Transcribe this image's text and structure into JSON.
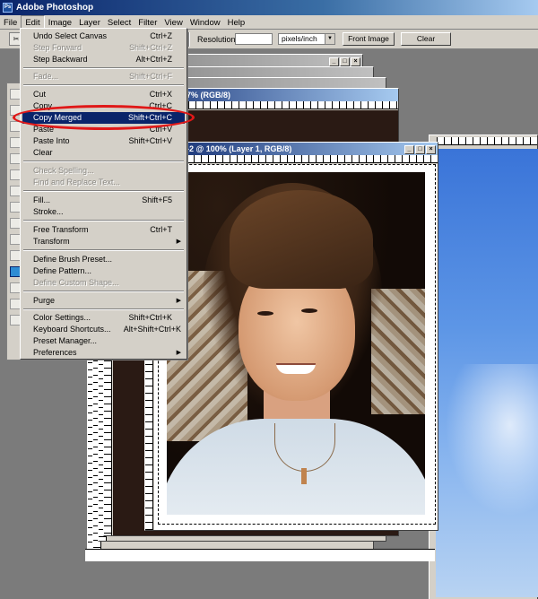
{
  "app": {
    "title": "Adobe Photoshop",
    "icon": "photoshop-app-icon"
  },
  "menubar": [
    "File",
    "Edit",
    "Image",
    "Layer",
    "Select",
    "Filter",
    "View",
    "Window",
    "Help"
  ],
  "options_bar": {
    "resolution_label": "Resolution:",
    "resolution_value": "",
    "resolution_unit": "pixels/inch",
    "front_image_label": "Front Image",
    "clear_label": "Clear"
  },
  "documents": {
    "back_title_fragment": "7% (RGB/8)",
    "front_title": "-2 @ 100% (Layer 1, RGB/8)",
    "window_buttons": [
      "_",
      "□",
      "×"
    ]
  },
  "edit_menu": {
    "items": [
      {
        "label": "Undo Select Canvas",
        "shortcut": "Ctrl+Z",
        "state": "enabled"
      },
      {
        "label": "Step Forward",
        "shortcut": "Shift+Ctrl+Z",
        "state": "disabled"
      },
      {
        "label": "Step Backward",
        "shortcut": "Alt+Ctrl+Z",
        "state": "enabled"
      },
      {
        "label": "Fade...",
        "shortcut": "Shift+Ctrl+F",
        "state": "disabled"
      },
      {
        "label": "Cut",
        "shortcut": "Ctrl+X",
        "state": "enabled"
      },
      {
        "label": "Copy",
        "shortcut": "Ctrl+C",
        "state": "enabled"
      },
      {
        "label": "Copy Merged",
        "shortcut": "Shift+Ctrl+C",
        "state": "highlighted"
      },
      {
        "label": "Paste",
        "shortcut": "Ctrl+V",
        "state": "enabled"
      },
      {
        "label": "Paste Into",
        "shortcut": "Shift+Ctrl+V",
        "state": "enabled"
      },
      {
        "label": "Clear",
        "shortcut": "",
        "state": "enabled"
      },
      {
        "label": "Check Spelling...",
        "shortcut": "",
        "state": "disabled"
      },
      {
        "label": "Find and Replace Text...",
        "shortcut": "",
        "state": "disabled"
      },
      {
        "label": "Fill...",
        "shortcut": "Shift+F5",
        "state": "enabled"
      },
      {
        "label": "Stroke...",
        "shortcut": "",
        "state": "enabled"
      },
      {
        "label": "Free Transform",
        "shortcut": "Ctrl+T",
        "state": "enabled"
      },
      {
        "label": "Transform",
        "shortcut": "",
        "state": "submenu"
      },
      {
        "label": "Define Brush Preset...",
        "shortcut": "",
        "state": "enabled"
      },
      {
        "label": "Define Pattern...",
        "shortcut": "",
        "state": "enabled"
      },
      {
        "label": "Define Custom Shape...",
        "shortcut": "",
        "state": "disabled"
      },
      {
        "label": "Purge",
        "shortcut": "",
        "state": "submenu"
      },
      {
        "label": "Color Settings...",
        "shortcut": "Shift+Ctrl+K",
        "state": "enabled"
      },
      {
        "label": "Keyboard Shortcuts...",
        "shortcut": "Alt+Shift+Ctrl+K",
        "state": "enabled"
      },
      {
        "label": "Preset Manager...",
        "shortcut": "",
        "state": "enabled"
      },
      {
        "label": "Preferences",
        "shortcut": "",
        "state": "submenu"
      }
    ]
  },
  "colors": {
    "accent": "#0a246a",
    "highlight_ring": "#e01818",
    "chrome": "#d4d0c8"
  }
}
